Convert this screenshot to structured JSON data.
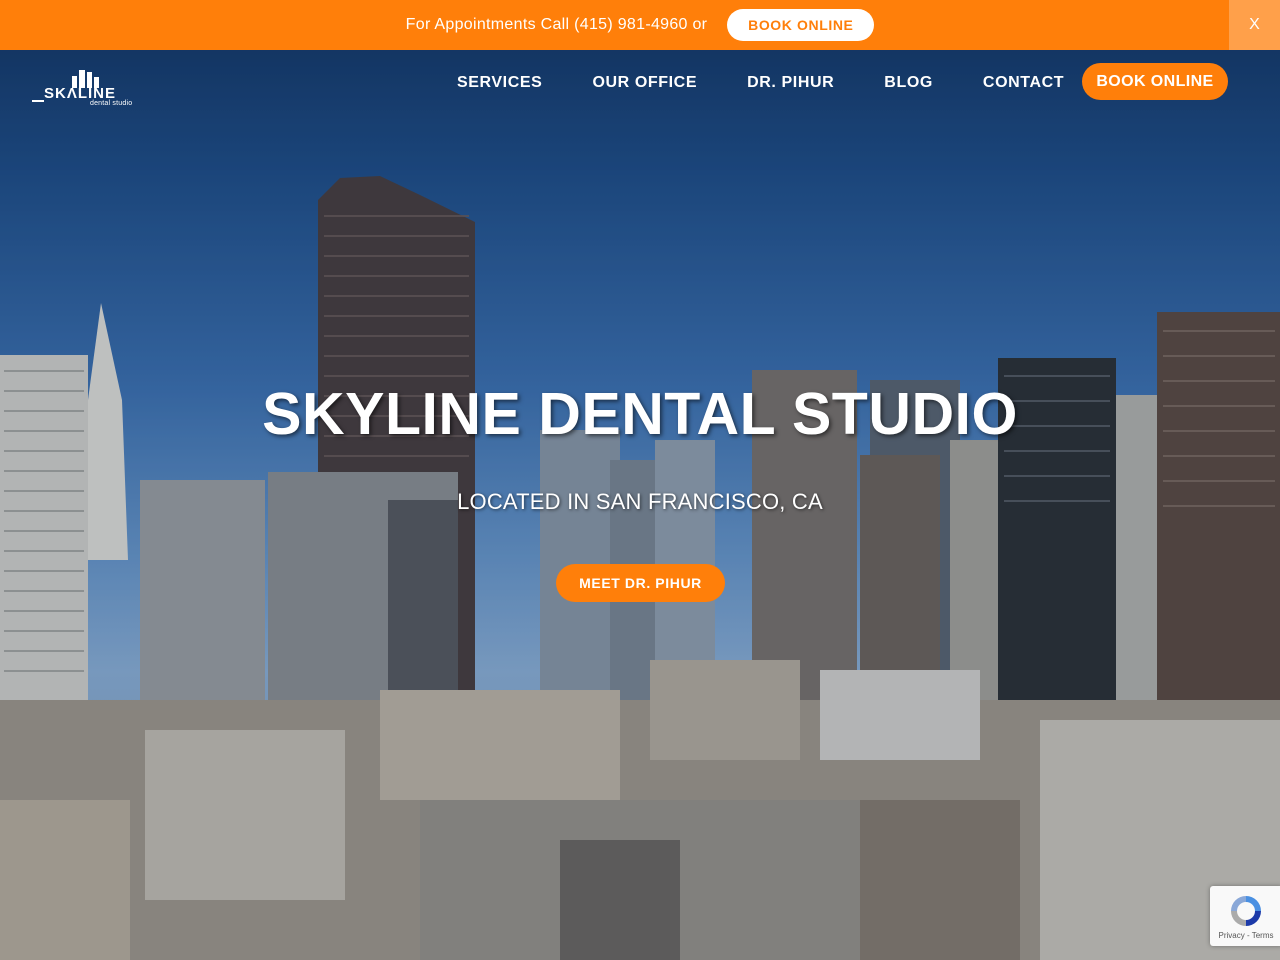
{
  "topbar": {
    "text": "For Appointments Call (415) 981-4960 or",
    "book_label": "BOOK ONLINE",
    "close_label": "X",
    "color": "#ff7f0a"
  },
  "header": {
    "logo": {
      "word": "SKΛLINE",
      "sub": "dental studio"
    },
    "nav": [
      {
        "label": "SERVICES"
      },
      {
        "label": "OUR OFFICE"
      },
      {
        "label": "DR. PIHUR"
      },
      {
        "label": "BLOG"
      },
      {
        "label": "CONTACT"
      }
    ],
    "book_label": "BOOK ONLINE"
  },
  "hero": {
    "title": "SKYLINE DENTAL STUDIO",
    "subtitle": "LOCATED IN SAN FRANCISCO, CA",
    "cta_label": "MEET DR. PIHUR"
  },
  "recaptcha": {
    "links": "Privacy - Terms"
  },
  "colors": {
    "accent": "#ff7f0a",
    "sky": "#1f4f8b"
  }
}
